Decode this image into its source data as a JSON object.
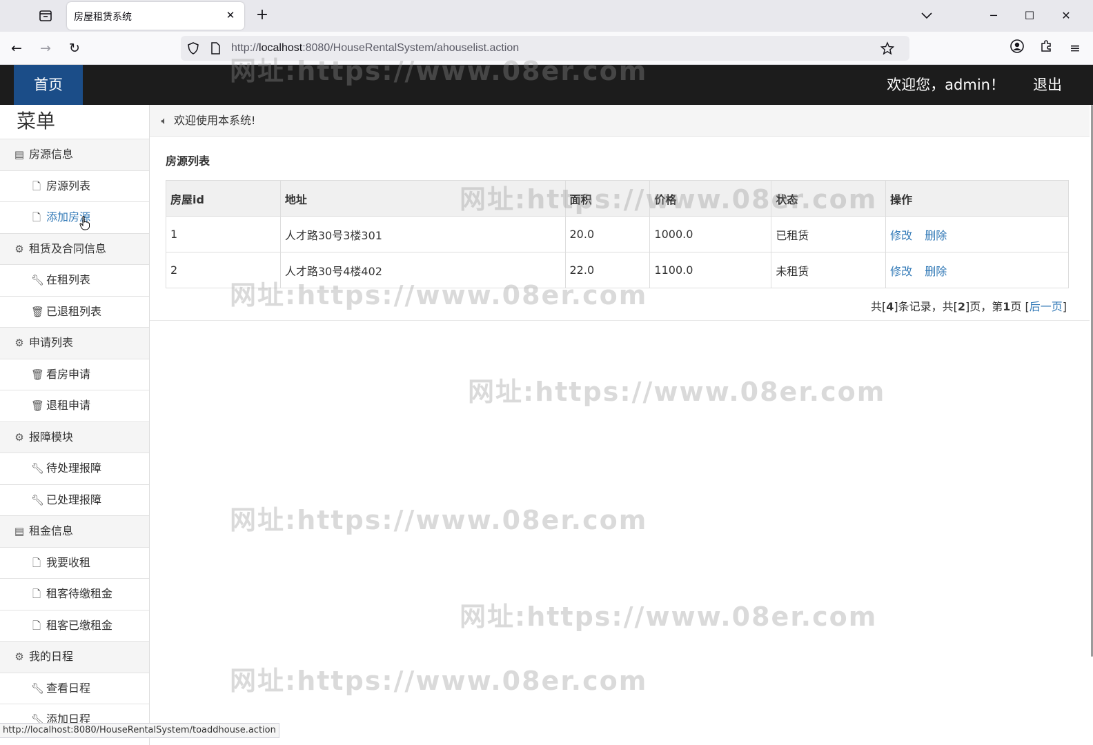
{
  "browser": {
    "tab_title": "房屋租赁系统",
    "url_prefix": "http://",
    "url_host": "localhost",
    "url_rest": ":8080/HouseRentalSystem/ahouselist.action",
    "status_url": "http://localhost:8080/HouseRentalSystem/toaddhouse.action"
  },
  "header": {
    "home_label": "首页",
    "welcome": "欢迎您，admin！",
    "logout_label": "退出"
  },
  "sidebar": {
    "title": "菜单",
    "groups": [
      {
        "label": "房源信息",
        "icon": "list-icon",
        "items": [
          {
            "label": "房源列表",
            "icon": "file-icon"
          },
          {
            "label": "添加房源",
            "icon": "file-icon"
          }
        ]
      },
      {
        "label": "租赁及合同信息",
        "icon": "gear-icon",
        "items": [
          {
            "label": "在租列表",
            "icon": "wrench-icon"
          },
          {
            "label": "已退租列表",
            "icon": "trash-icon"
          }
        ]
      },
      {
        "label": "申请列表",
        "icon": "gear-icon",
        "items": [
          {
            "label": "看房申请",
            "icon": "trash-icon"
          },
          {
            "label": "退租申请",
            "icon": "trash-icon"
          }
        ]
      },
      {
        "label": "报障模块",
        "icon": "gear-icon",
        "items": [
          {
            "label": "待处理报障",
            "icon": "wrench-icon"
          },
          {
            "label": "已处理报障",
            "icon": "wrench-icon"
          }
        ]
      },
      {
        "label": "租金信息",
        "icon": "list-icon",
        "items": [
          {
            "label": "我要收租",
            "icon": "file-icon"
          },
          {
            "label": "租客待缴租金",
            "icon": "file-icon"
          },
          {
            "label": "租客已缴租金",
            "icon": "file-icon"
          }
        ]
      },
      {
        "label": "我的日程",
        "icon": "gear-icon",
        "items": [
          {
            "label": "查看日程",
            "icon": "wrench-icon"
          },
          {
            "label": "添加日程",
            "icon": "wrench-icon"
          }
        ]
      }
    ]
  },
  "main": {
    "notice": "欢迎使用本系统!",
    "panel_title": "房源列表",
    "columns": [
      "房屋id",
      "地址",
      "面积",
      "价格",
      "状态",
      "操作"
    ],
    "rows": [
      {
        "id": "1",
        "address": "人才路30号3楼301",
        "area": "20.0",
        "price": "1000.0",
        "status": "已租赁",
        "edit": "修改",
        "delete": "删除"
      },
      {
        "id": "2",
        "address": "人才路30号4楼402",
        "area": "22.0",
        "price": "1100.0",
        "status": "未租赁",
        "edit": "修改",
        "delete": "删除"
      }
    ],
    "pager": {
      "text1": "共[",
      "total": "4",
      "text2": "]条记录，共[",
      "pages": "2",
      "text3": "]页，第",
      "current": "1",
      "text4": "页 [",
      "next_label": "后一页",
      "text5": "]"
    }
  },
  "watermark_text": "网址:https://www.08er.com"
}
